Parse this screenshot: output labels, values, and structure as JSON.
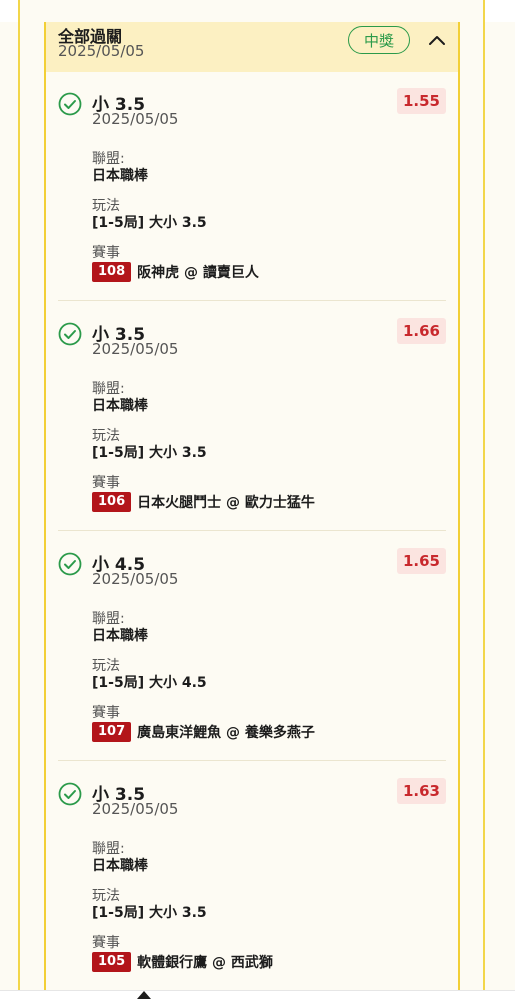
{
  "group": {
    "title": "全部過關",
    "date": "2025/05/05",
    "status": "中獎",
    "toggle_icon": "chevron-up-icon"
  },
  "labels": {
    "league": "聯盟:",
    "market": "玩法",
    "event": "賽事"
  },
  "bets": [
    {
      "selection": "小 3.5",
      "date": "2025/05/05",
      "odds": "1.55",
      "league": "日本職棒",
      "market": "[1-5局] 大小 3.5",
      "event_no": "108",
      "event": "阪神虎 @ 讀賣巨人"
    },
    {
      "selection": "小 3.5",
      "date": "2025/05/05",
      "odds": "1.66",
      "league": "日本職棒",
      "market": "[1-5局] 大小 3.5",
      "event_no": "106",
      "event": "日本火腿鬥士 @ 歐力士猛牛"
    },
    {
      "selection": "小 4.5",
      "date": "2025/05/05",
      "odds": "1.65",
      "league": "日本職棒",
      "market": "[1-5局] 大小 4.5",
      "event_no": "107",
      "event": "廣島東洋鯉魚 @ 養樂多燕子"
    },
    {
      "selection": "小 3.5",
      "date": "2025/05/05",
      "odds": "1.63",
      "league": "日本職棒",
      "market": "[1-5局] 大小 3.5",
      "event_no": "105",
      "event": "軟體銀行鷹 @ 西武獅"
    }
  ],
  "colors": {
    "win_green": "#2b9a4a",
    "odds_red": "#c8282c",
    "event_badge": "#b3151a",
    "accent_yellow": "#f2cf36"
  }
}
